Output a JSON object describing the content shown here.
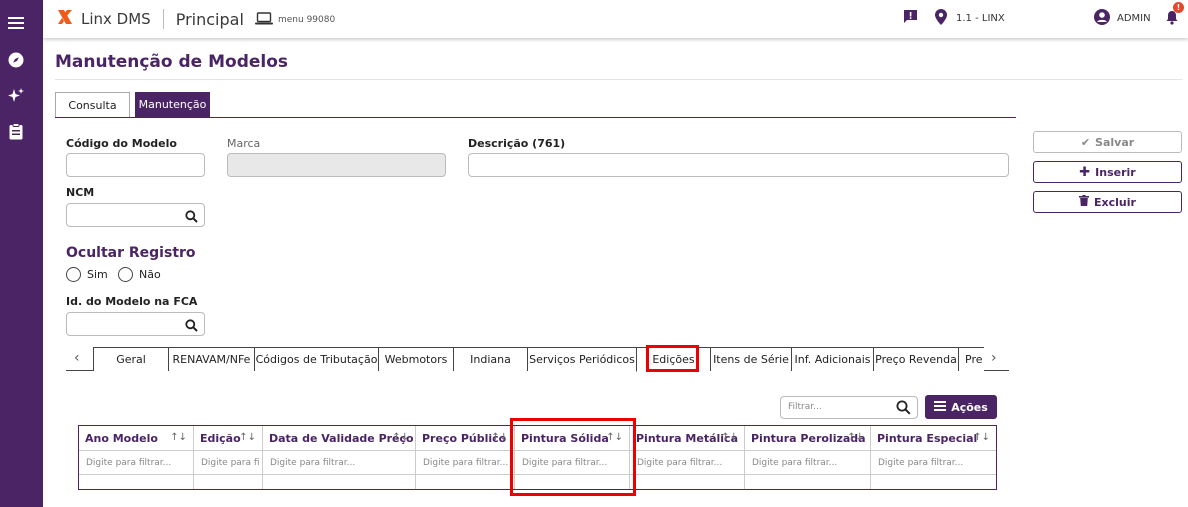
{
  "app": {
    "brand": "Linx DMS",
    "page": "Principal",
    "menu_label": "menu 99080"
  },
  "header": {
    "location": "1.1 - LINX",
    "user": "ADMIN",
    "notification_badge": "!"
  },
  "page_title": "Manutenção de Modelos",
  "tabs": [
    {
      "label": "Consulta"
    },
    {
      "label": "Manutenção"
    }
  ],
  "form": {
    "codigo_label": "Código do Modelo",
    "marca_label": "Marca",
    "descricao_label": "Descrição (761)",
    "ncm_label": "NCM",
    "ocultar_label": "Ocultar Registro",
    "radio_sim": "Sim",
    "radio_nao": "Não",
    "fca_label": "Id. do Modelo na FCA"
  },
  "actions": {
    "salvar": "Salvar",
    "inserir": "Inserir",
    "excluir": "Excluir"
  },
  "subtabs": [
    {
      "label": "Geral"
    },
    {
      "label": "RENAVAM/NFe"
    },
    {
      "label": "Códigos de Tributação"
    },
    {
      "label": "Webmotors"
    },
    {
      "label": "Indiana"
    },
    {
      "label": "Serviços Periódicos"
    },
    {
      "label": "Edições"
    },
    {
      "label": "Itens de Série"
    },
    {
      "label": "Inf. Adicionais"
    },
    {
      "label": "Preço Revenda"
    },
    {
      "label": "Pre"
    }
  ],
  "grid": {
    "filter_placeholder": "Filtrar...",
    "acoes_label": "Ações",
    "columns": [
      {
        "label": "Ano Modelo",
        "filter": "Digite para filtrar..."
      },
      {
        "label": "Edição",
        "filter": "Digite para fi"
      },
      {
        "label": "Data de Validade Preço",
        "filter": "Digite para filtrar..."
      },
      {
        "label": "Preço Público",
        "filter": "Digite para filtrar..."
      },
      {
        "label": "Pintura Sólida",
        "filter": "Digite para filtrar..."
      },
      {
        "label": "Pintura Metálica",
        "filter": "Digite para filtrar..."
      },
      {
        "label": "Pintura Perolizada",
        "filter": "Digite para filtrar..."
      },
      {
        "label": "Pintura Especial",
        "filter": "Digite para filtrar..."
      }
    ]
  },
  "colors": {
    "primary": "#4a2464",
    "highlight": "#e00000",
    "logo": "#f05a1a"
  }
}
